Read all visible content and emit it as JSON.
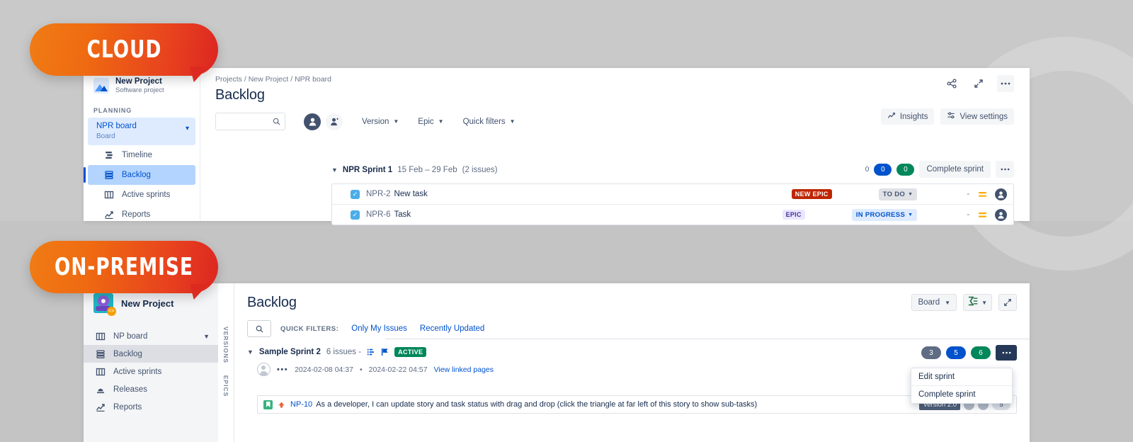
{
  "badges": {
    "cloud": "CLOUD",
    "onpremise": "ON-PREMISE"
  },
  "cloud": {
    "sidebar": {
      "project_name": "New Project",
      "project_type": "Software project",
      "section_label": "PLANNING",
      "board_name": "NPR board",
      "board_sub": "Board",
      "items": [
        {
          "label": "Timeline",
          "icon": "timeline-icon"
        },
        {
          "label": "Backlog",
          "icon": "backlog-icon"
        },
        {
          "label": "Active sprints",
          "icon": "board-columns-icon"
        },
        {
          "label": "Reports",
          "icon": "reports-icon"
        }
      ]
    },
    "breadcrumb": {
      "item1": "Projects",
      "sep1": "/",
      "item2": "New Project",
      "sep2": "/",
      "item3": "NPR board"
    },
    "page_title": "Backlog",
    "toolbar": {
      "search_placeholder": "",
      "search_value": "",
      "version_label": "Version",
      "epic_label": "Epic",
      "quick_filters_label": "Quick filters",
      "insights_label": "Insights",
      "view_settings_label": "View settings"
    },
    "sprint": {
      "name": "NPR Sprint 1",
      "dates": "15 Feb – 29 Feb",
      "issue_count": "(2 issues)",
      "count_grey": "0",
      "count_blue": "0",
      "count_green": "0",
      "complete_label": "Complete sprint",
      "more_label": "•••"
    },
    "issues": [
      {
        "key": "NPR-2",
        "summary": "New task",
        "epic": "NEW EPIC",
        "epic_style": "new",
        "status": "TO DO",
        "status_style": "todo",
        "points": "-"
      },
      {
        "key": "NPR-6",
        "summary": "Task",
        "epic": "EPIC",
        "epic_style": "epic",
        "status": "IN PROGRESS",
        "status_style": "progress",
        "points": "-"
      }
    ]
  },
  "onprem": {
    "sidebar": {
      "project_name": "New Project",
      "board_label": "NP board",
      "items": [
        {
          "label": "Backlog",
          "icon": "backlog-icon"
        },
        {
          "label": "Active sprints",
          "icon": "board-columns-icon"
        },
        {
          "label": "Releases",
          "icon": "releases-icon"
        },
        {
          "label": "Reports",
          "icon": "reports-icon"
        }
      ]
    },
    "rail": {
      "versions": "VERSIONS",
      "epics": "EPICS"
    },
    "page_title": "Backlog",
    "filters": {
      "label": "QUICK FILTERS:",
      "items": [
        "Only My Issues",
        "Recently Updated"
      ]
    },
    "topright": {
      "board_label": "Board",
      "export_label": "",
      "expand_label": ""
    },
    "sprint": {
      "name": "Sample Sprint 2",
      "meta": "6 issues -",
      "status_badge": "ACTIVE",
      "start": "2024-02-08 04:37",
      "mid_dot": "•",
      "end": "2024-02-22 04:57",
      "link": "View linked pages",
      "count_grey": "3",
      "count_blue": "5",
      "count_green": "6",
      "more_label": "•••"
    },
    "menu": {
      "items": [
        "Edit sprint",
        "Complete sprint"
      ]
    },
    "issue": {
      "key": "NP-10",
      "summary": "As a developer, I can update story and task status with drag and drop (click the triangle at far left of this story to show sub-tasks)",
      "version": "Version 2.0",
      "estimate": "5"
    }
  },
  "colors": {
    "accent_orange": "#ef6a11",
    "accent_red": "#dc2522",
    "blue": "#0052cc",
    "green": "#00875a",
    "grey": "#5e6c84",
    "dark_navy": "#253858"
  }
}
